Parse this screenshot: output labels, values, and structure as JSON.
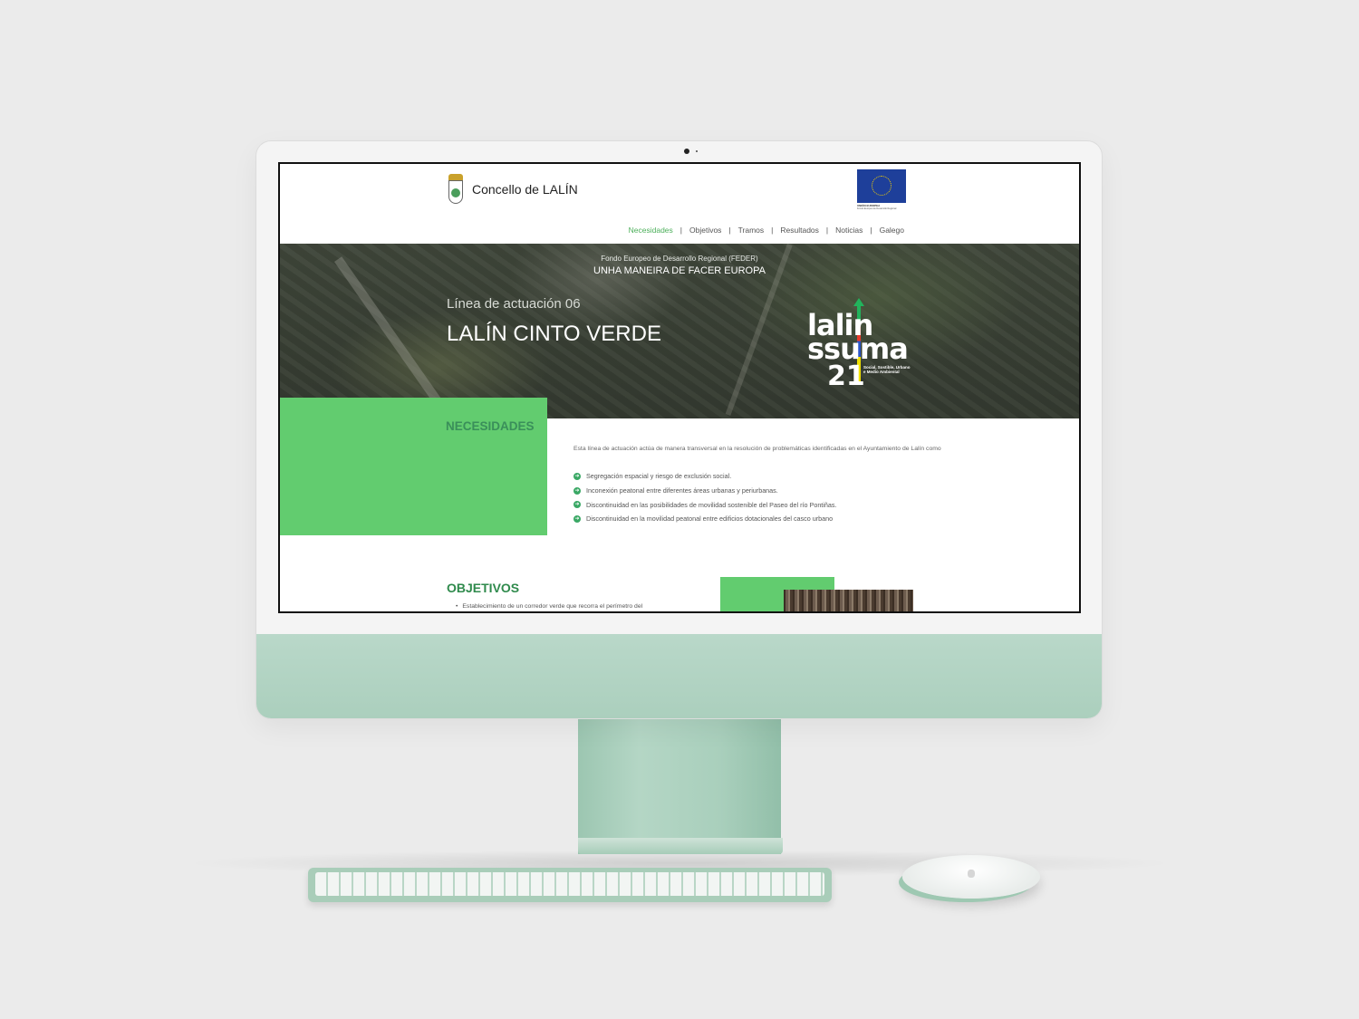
{
  "site": {
    "logo_text": "Concello de LALÍN",
    "eu_label": "UNIÓN EUROPEA",
    "eu_sublabel": "Fondo Europeo de Desarrollo Regional"
  },
  "nav": {
    "items": [
      {
        "label": "Necesidades",
        "active": true
      },
      {
        "label": "Objetivos"
      },
      {
        "label": "Tramos"
      },
      {
        "label": "Resultados"
      },
      {
        "label": "Noticias"
      },
      {
        "label": "Galego"
      }
    ],
    "separator": "|"
  },
  "hero": {
    "fund": "Fondo Europeo de Desarrollo Regional (FEDER)",
    "motto": "UNHA MANEIRA DE FACER EUROPA",
    "subtitle": "Línea de actuación 06",
    "title": "LALÍN CINTO VERDE",
    "brand_row1": "lalin",
    "brand_row2": "ssuma",
    "brand_row3": "21",
    "brand_tagline_1": "Social, Sostible, Urbano",
    "brand_tagline_2": "e Medio Ambiental"
  },
  "necesidades": {
    "title": "NECESIDADES",
    "intro": "Esta línea de actuación actúa de manera transversal en la resolución de problemáticas identificadas en el Ayuntamiento de Lalín como",
    "items": [
      "Segregación espacial y riesgo de exclusión social.",
      "Inconexión peatonal entre diferentes áreas urbanas y periurbanas.",
      "Discontinuidad en las posibilidades de movilidad sostenible del Paseo del río Pontiñas.",
      "Discontinuidad en la movilidad peatonal entre edificios dotacionales del casco urbano"
    ]
  },
  "objetivos": {
    "title": "OBJETIVOS",
    "first_item": "Establecimiento de un corredor verde que recorra el perímetro del"
  },
  "colors": {
    "accent_green": "#62cc6f",
    "title_green": "#3a8f5a",
    "eu_blue": "#1e3f9a",
    "device_green": "#b4d6c5"
  }
}
